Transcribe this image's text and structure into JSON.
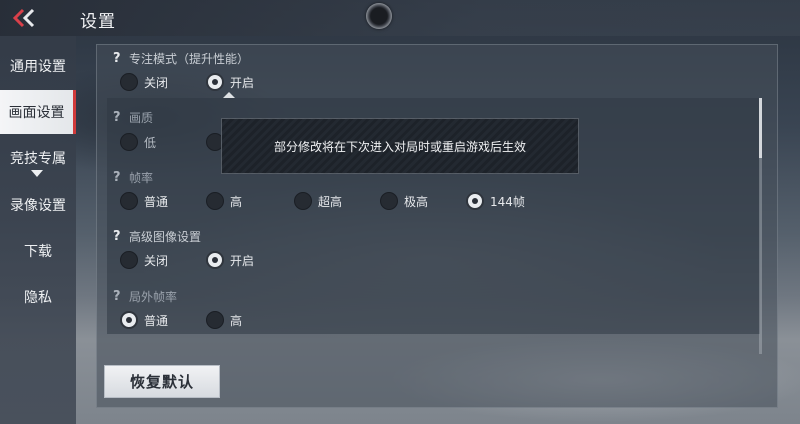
{
  "header": {
    "title": "设置",
    "back_icon": "double-chevron-left-icon"
  },
  "sidebar": {
    "items": [
      {
        "label": "通用设置",
        "active": false
      },
      {
        "label": "画面设置",
        "active": true
      },
      {
        "label": "竞技专属",
        "active": false
      },
      {
        "label": "录像设置",
        "active": false
      },
      {
        "label": "下载",
        "active": false
      },
      {
        "label": "隐私",
        "active": false
      }
    ],
    "accent_color": "#d03a3a"
  },
  "settings": {
    "focus_mode": {
      "label": "专注模式（提升性能）",
      "options": [
        "关闭",
        "开启"
      ],
      "selected": "开启"
    },
    "quality": {
      "label": "画质",
      "options": [
        "低"
      ],
      "selected": null
    },
    "frame_rate": {
      "label": "帧率",
      "options": [
        "普通",
        "高",
        "超高",
        "极高",
        "144帧"
      ],
      "selected": "144帧"
    },
    "advanced_graphics": {
      "label": "高级图像设置",
      "options": [
        "关闭",
        "开启"
      ],
      "selected": "开启"
    },
    "outside_frame_rate": {
      "label": "局外帧率",
      "options": [
        "普通",
        "高"
      ],
      "selected": "普通"
    }
  },
  "toast": {
    "message": "部分修改将在下次进入对局时或重启游戏后生效"
  },
  "reset_button": {
    "label": "恢复默认"
  }
}
